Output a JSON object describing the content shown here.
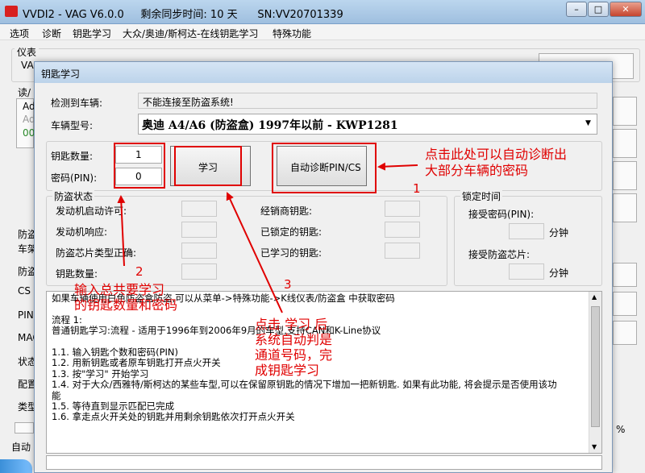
{
  "main_window": {
    "title": "VVDI2 - VAG V6.0.0     剩余同步时间: 10 天      SN:VV20701339",
    "min_label": "–",
    "max_label": "□",
    "close_label": "✕"
  },
  "menu": [
    "选项",
    "诊断",
    "钥匙学习",
    "大众/奥迪/斯柯达-在线钥匙学习",
    "特殊功能"
  ],
  "background": {
    "left_labels": [
      "仪表",
      "VA",
      "读/",
      "Ad",
      "Ad",
      "00",
      "防盗",
      "车架",
      "防盗",
      "CS",
      "PIN",
      "MAC",
      "状态",
      "配置",
      "类型",
      "自动"
    ],
    "percent": "%"
  },
  "dialog": {
    "title": "钥匙学习",
    "detected_vehicle_label": "检测到车辆:",
    "detected_vehicle_value": "不能连接至防盗系统!",
    "model_label": "车辆型号:",
    "model_value": "奥迪 A4/A6 (防盗盒) 1997年以前 - KWP1281",
    "key_count_label": "钥匙数量:",
    "key_count_value": "1",
    "pin_label": "密码(PIN):",
    "pin_value": "0",
    "learn_button": "学习",
    "auto_pin_button": "自动诊断PIN/CS",
    "immo_group": {
      "title": "防盗状态",
      "left_labels": [
        "发动机启动许可:",
        "发动机响应:",
        "防盗芯片类型正确:",
        "钥匙数量:"
      ],
      "right_labels": [
        "经销商钥匙:",
        "已锁定的钥匙:",
        "已学习的钥匙:"
      ]
    },
    "lock_group": {
      "title": "锁定时间",
      "accept_pin_label": "接受密码(PIN):",
      "accept_chip_label": "接受防盗芯片:",
      "unit1": "分钟",
      "unit2": "分钟"
    },
    "info_lines": [
      "如果车辆使用白色防盗盒防盗,可以从菜单->特殊功能->K线仪表/防盗盒 中获取密码",
      "",
      "流程 1:",
      "普通钥匙学习:流程 - 适用于1996年到2006年9月的车型,支持CAN和K-Line协议",
      "",
      "1.1. 输入钥匙个数和密码(PIN)",
      "1.2. 用新钥匙或者原车钥匙打开点火开关",
      "1.3. 按\"学习\" 开始学习",
      "1.4. 对于大众/西雅特/斯柯达的某些车型,可以在保留原钥匙的情况下增加一把新钥匙. 如果有此功能, 将会提示是否使用该功",
      "能",
      "1.5. 等待直到显示匹配已完成",
      "1.6. 拿走点火开关处的钥匙并用剩余钥匙依次打开点火开关"
    ]
  },
  "annotations": {
    "a1_line1": "点击此处可以自动诊断出",
    "a1_line2": "大部分车辆的密码",
    "a1_num": "1",
    "a2_num": "2",
    "a2_line1": "输入总共要学习",
    "a2_line2": "的钥匙数量和密码",
    "a3_num": "3",
    "a3_line1": "点击 学习 后",
    "a3_line2": "系统自动判是",
    "a3_line3": "通道号码，完",
    "a3_line4": "成钥匙学习"
  },
  "colors": {
    "annotation_red": "#e00000",
    "title_blue": "#bcd6ee"
  }
}
